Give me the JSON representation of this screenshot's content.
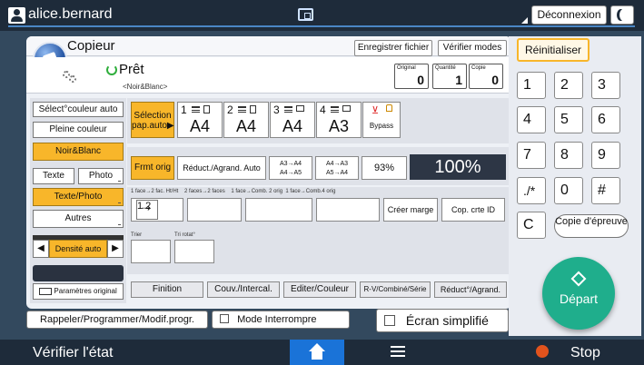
{
  "topbar": {
    "username": "alice.bernard",
    "logout_label": "Déconnexion"
  },
  "copier": {
    "title": "Copieur",
    "save_file_label": "Enregistrer fichier",
    "check_modes_label": "Vérifier modes",
    "status": "Prêt",
    "status_sub": "<Noir&Blanc>",
    "counters": [
      {
        "label": "Original",
        "value": "0"
      },
      {
        "label": "Quantité",
        "value": "1"
      },
      {
        "label": "Copie",
        "value": "0"
      }
    ]
  },
  "left": {
    "color_select": "Sélect°couleur auto",
    "full_color": "Pleine couleur",
    "bw": "Noir&Blanc",
    "text": "Texte",
    "photo": "Photo",
    "text_photo": "Texte/Photo",
    "others": "Autres",
    "density": "Densité auto",
    "orig_settings": "Paramètres original"
  },
  "paper": {
    "auto_select": "Sélection pap.auto▶",
    "trays": [
      {
        "num": "1",
        "size": "A4"
      },
      {
        "num": "2",
        "size": "A4"
      },
      {
        "num": "3",
        "size": "A4"
      },
      {
        "num": "4",
        "size": "A3"
      }
    ],
    "bypass": "Bypass"
  },
  "reduction": {
    "full_size": "Frmt orig",
    "auto_reduce": "Réduct./Agrand. Auto",
    "r1_top": "A3→A4",
    "r1_bot": "A4→A5",
    "r2_top": "A4→A3",
    "r2_bot": "A5→A4",
    "percent_small": "93%",
    "percent_big": "100%"
  },
  "layout": {
    "caption": "1 face→2 fac. Ht/Ht    2 faces→2 faces    1 face→Comb. 2 orig  1 face→Comb.4 orig",
    "create_margin": "Créer marge",
    "copy_id": "Cop. crte ID",
    "sort_label": "Trier",
    "rotate_sort_label": "Tri rotat°"
  },
  "tabs": [
    "Finition",
    "Couv./Intercal.",
    "Editer/Couleur",
    "R-V/Combiné/Série",
    "Réduct°/Agrand."
  ],
  "bottom_controls": {
    "recall": "Rappeler/Programmer/Modif.progr.",
    "interrupt": "Mode Interrompre",
    "simple_screen": "Écran simplifié"
  },
  "keypad": {
    "reset": "Réinitialiser",
    "keys": [
      "1",
      "2",
      "3",
      "4",
      "5",
      "6",
      "7",
      "8",
      "9",
      "./*",
      "0",
      "#"
    ],
    "clear": "C",
    "proof_copy": "Copie d'épreuve",
    "start": "Départ"
  },
  "bottom": {
    "check_status": "Vérifier l'état",
    "stop": "Stop"
  },
  "colors": {
    "accent_yellow": "#f8b62a",
    "start_green": "#1fae8c",
    "topbar_dark": "#1e2b3a",
    "bg": "#33495e",
    "stop_icon": "#e2531d",
    "home_blue": "#1a73d8"
  }
}
